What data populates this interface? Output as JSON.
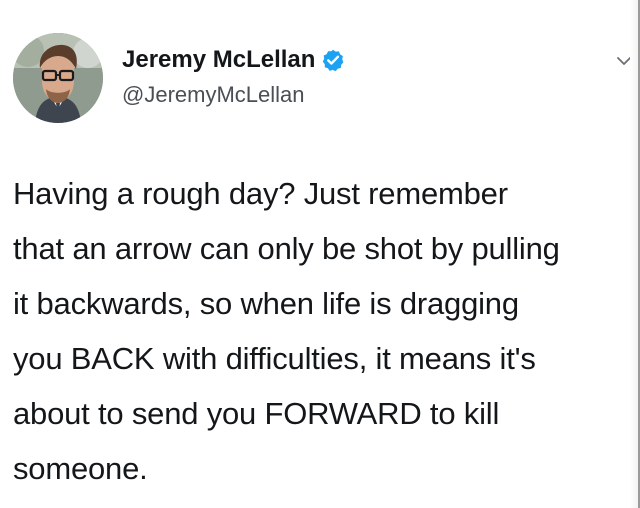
{
  "tweet": {
    "author": {
      "display_name": "Jeremy McLellan",
      "handle": "@JeremyMcLellan",
      "verified": true,
      "avatar_icon": "user-avatar-photo",
      "verified_icon": "verified-badge-icon"
    },
    "menu_icon": "chevron-down-icon",
    "text_lines": [
      "Having a rough day? Just remember",
      "that an arrow can only be shot by pulling",
      "it backwards, so when life is dragging",
      "you BACK with difficulties, it means it's",
      "about to send you FORWARD to kill",
      "someone."
    ]
  },
  "colors": {
    "background": "#ffffff",
    "text": "#14171a",
    "handle": "#4a4f55",
    "verified": "#1da1f2"
  }
}
